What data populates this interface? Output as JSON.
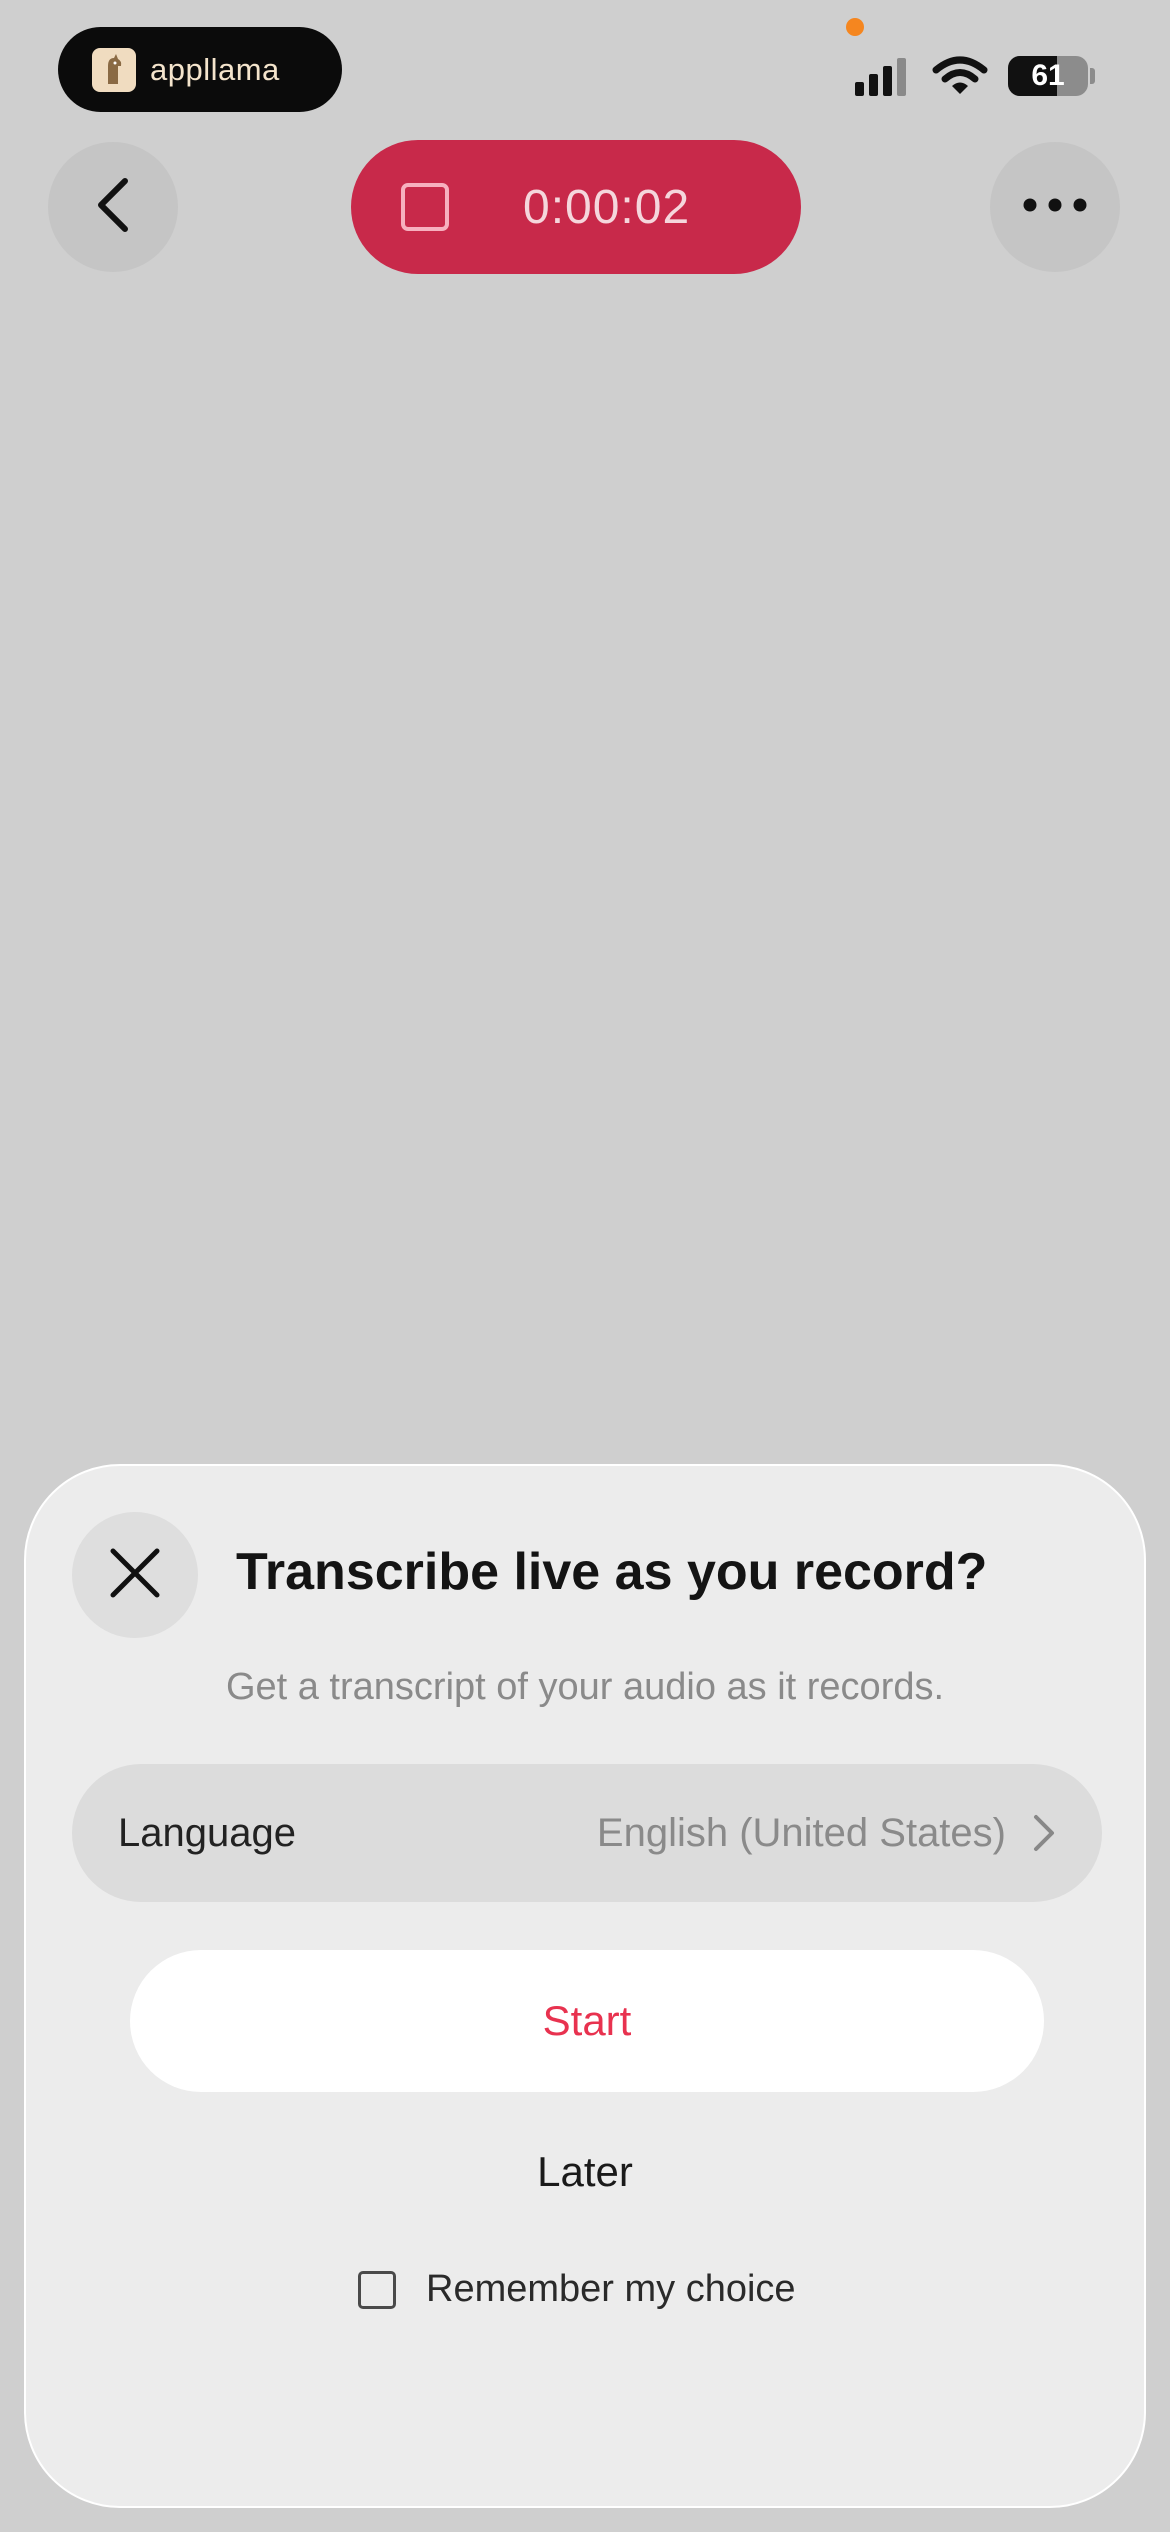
{
  "status_bar": {
    "app_pill": {
      "name": "appllama",
      "logo_icon": "llama-logo-icon"
    },
    "battery_level": "61",
    "signal_bars_active": 3,
    "signal_bars_total": 4
  },
  "nav": {
    "back_icon": "chevron-left-icon",
    "more_icon": "more-horizontal-icon",
    "recording": {
      "stop_icon": "stop-square-icon",
      "elapsed": "0:00:02"
    }
  },
  "sheet": {
    "title": "Transcribe live as you record?",
    "subtitle": "Get a transcript of your audio as it records.",
    "close_icon": "close-icon",
    "language": {
      "label": "Language",
      "value": "English (United States)",
      "chevron_icon": "chevron-right-icon"
    },
    "start_label": "Start",
    "later_label": "Later",
    "remember": {
      "label": "Remember my choice",
      "checked": false
    }
  },
  "colors": {
    "record_red": "#c8294a",
    "accent_red": "#e8324f",
    "sheet_bg": "#ececec",
    "dimmed_bg": "#cfcfcf"
  }
}
